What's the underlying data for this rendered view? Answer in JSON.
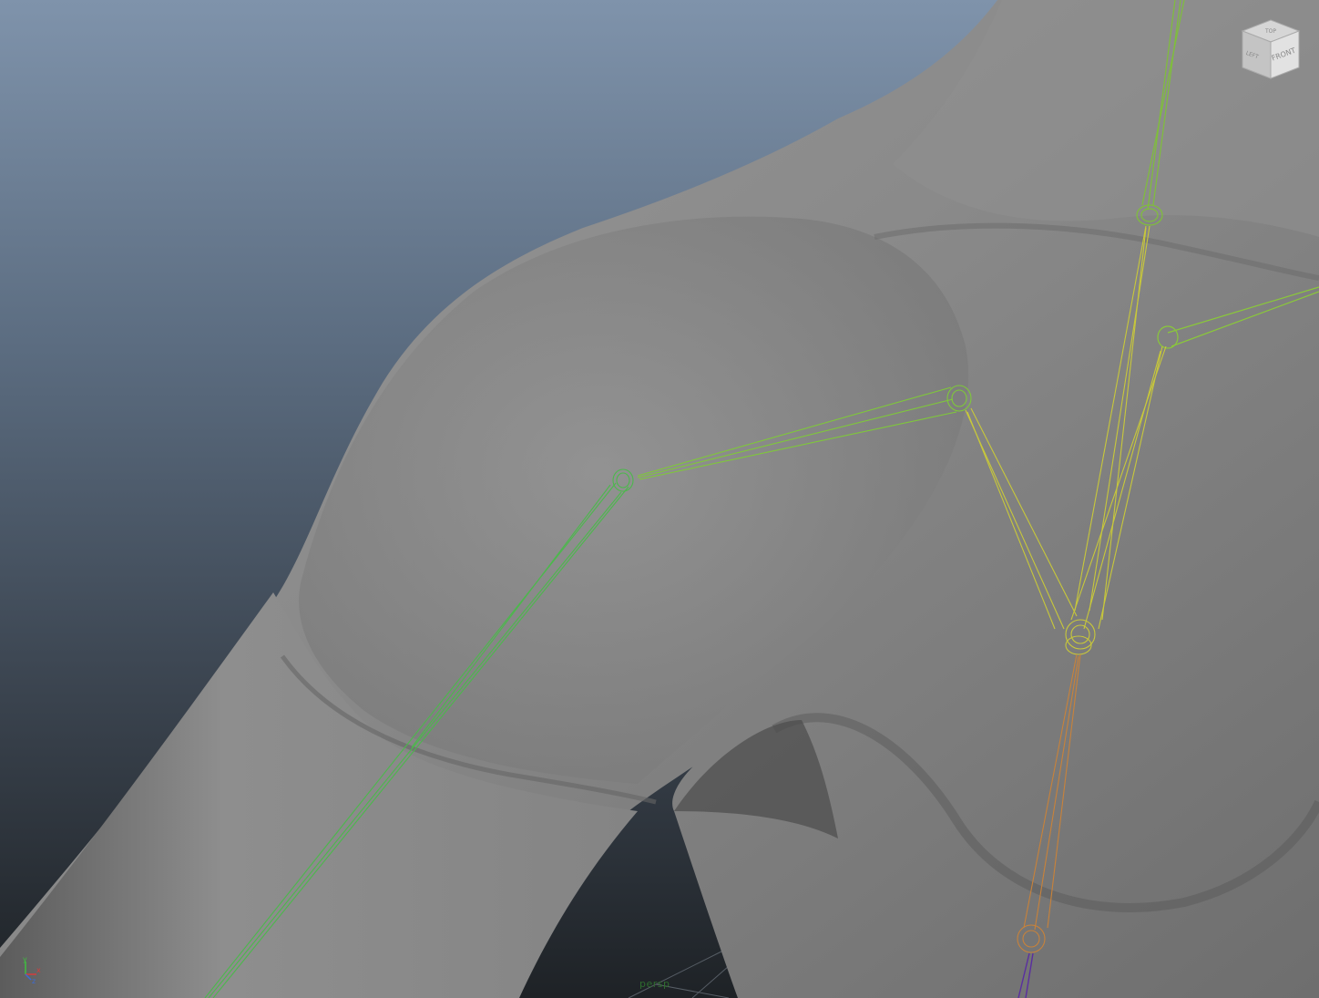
{
  "viewport": {
    "camera_label": "persp"
  },
  "view_cube": {
    "top_label": "TOP",
    "front_label": "FRONT",
    "left_label": "LEFT"
  },
  "axis": {
    "y_label": "y",
    "x_label": "x",
    "z_label": "z",
    "y_color": "#3fbf3f",
    "x_color": "#d43c3c",
    "z_color": "#3c6bd4"
  },
  "colors": {
    "mesh": "#8a8a8a",
    "joint_green": "#5cc84a",
    "joint_yellow": "#c8c83a",
    "joint_orange": "#c8823a",
    "joint_purple": "#5a2ea0"
  }
}
